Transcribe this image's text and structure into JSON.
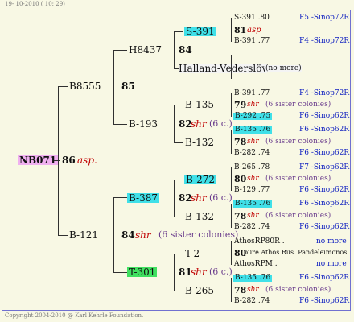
{
  "header": {
    "date": "19- 10-2010 ( 10: 29)"
  },
  "footer": {
    "copyright": "Copyright 2004-2010 @ Karl Kehrle Foundation."
  },
  "root": {
    "id": "NB071",
    "num": "86",
    "breed": "asp."
  },
  "g1": {
    "upper": {
      "id": "B8555",
      "num": "85"
    },
    "lower": {
      "id": "B-121",
      "num": "84",
      "breed": "shr",
      "note": "(6 sister colonies)"
    }
  },
  "g2": {
    "a": {
      "id": "H8437",
      "num": "84"
    },
    "b": {
      "id": "B-193",
      "num": "82",
      "breed": "shr",
      "note": "(6 c.)"
    },
    "c": {
      "id": "B-387",
      "num": "82",
      "breed": "shr",
      "note": "(6 c.)"
    },
    "d": {
      "id": "T-301",
      "num": "81",
      "breed": "shr",
      "note": "(6 c.)"
    }
  },
  "g3": {
    "a1": {
      "id": "S-391"
    },
    "a2": {
      "id": "Halland-Vederslöv",
      "note": "(no more)"
    },
    "b1": {
      "id": "B-135"
    },
    "b2": {
      "id": "B-132"
    },
    "c1": {
      "id": "B-272"
    },
    "c2": {
      "id": "B-132"
    },
    "d1": {
      "id": "T-2"
    },
    "d2": {
      "id": "B-265"
    }
  },
  "g4": [
    {
      "top": "S-391 .80",
      "num": "81",
      "breed": "asp",
      "note": "",
      "bot": "B-391 .77",
      "topSrc": "F5 -Sinop72R",
      "botSrc": "F4 -Sinop72R"
    },
    {
      "top": "B-391 .77",
      "num": "79",
      "breed": "shr",
      "note": "(6 sister colonies)",
      "bot": "B-292 .75",
      "topSrc": "F4 -Sinop72R",
      "botSrc": "F6 -Sinop62R"
    },
    {
      "top": "B-135 .76",
      "num": "78",
      "breed": "shr",
      "note": "(6 sister colonies)",
      "bot": "B-282 .74",
      "topSrc": "F6 -Sinop62R",
      "botSrc": "F6 -Sinop62R"
    },
    {
      "top": "B-265 .78",
      "num": "80",
      "breed": "shr",
      "note": "(6 sister colonies)",
      "bot": "B-129 .77",
      "topSrc": "F7 -Sinop62R",
      "botSrc": "F6 -Sinop62R"
    },
    {
      "top": "B-135 .76",
      "num": "78",
      "breed": "shr",
      "note": "(6 sister colonies)",
      "bot": "B-282 .74",
      "topSrc": "F6 -Sinop62R",
      "botSrc": "F6 -Sinop62R"
    },
    {
      "top": "AthosRP80R .",
      "num": "80",
      "breed": "",
      "note": "pure Athos Rus. Pandeleimonos",
      "bot": "AthosRPM .",
      "topSrc": "no more",
      "botSrc": "no more"
    },
    {
      "top": "B-135 .76",
      "num": "78",
      "breed": "shr",
      "note": "(6 sister colonies)",
      "bot": "B-282 .74",
      "topSrc": "F6 -Sinop62R",
      "botSrc": "F6 -Sinop62R"
    }
  ]
}
